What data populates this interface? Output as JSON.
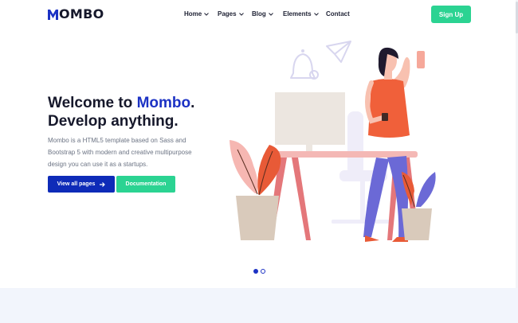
{
  "brand": {
    "name": "OMBO",
    "accent_color": "#1c32c4",
    "logo_icon": "m-logo-icon"
  },
  "nav": {
    "items": [
      {
        "label": "Home",
        "has_dropdown": true
      },
      {
        "label": "Pages",
        "has_dropdown": true
      },
      {
        "label": "Blog",
        "has_dropdown": true
      },
      {
        "label": "Elements",
        "has_dropdown": true
      },
      {
        "label": "Contact",
        "has_dropdown": false
      }
    ],
    "signup_label": "Sign Up",
    "signup_color": "#2bd392"
  },
  "hero": {
    "title_prefix": "Welcome to ",
    "title_brand": "Mombo",
    "title_suffix": ".",
    "title_line2": "Develop anything.",
    "description": "Mombo is a HTML5 template based on Sass and Bootstrap 5 with modern and creative multipurpose design you can use it as a startups.",
    "primary_button": "View all pages",
    "primary_button_icon": "arrow-right-icon",
    "secondary_button": "Documentation",
    "primary_color": "#0e2bb8"
  },
  "slider": {
    "total": 2,
    "active": 1
  }
}
